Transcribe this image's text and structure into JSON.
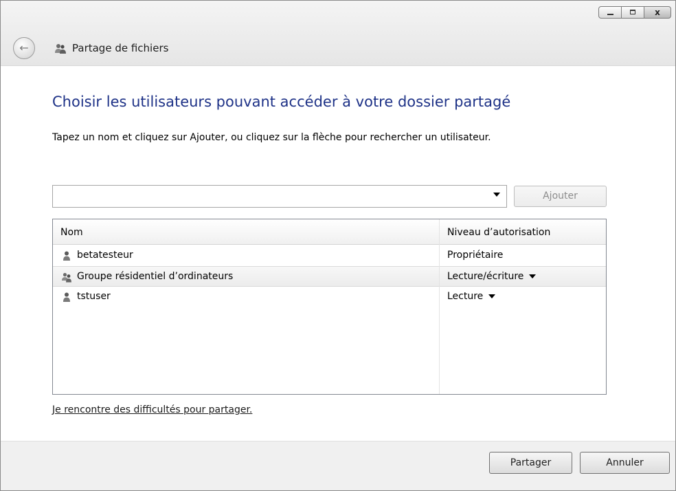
{
  "window": {
    "title": "Partage de fichiers",
    "close_glyph": "x"
  },
  "icons": {
    "back": "back-arrow-icon",
    "title": "users-share-icon",
    "user": "user-icon",
    "group": "group-icon",
    "dropdown": "chevron-down-icon"
  },
  "main": {
    "heading": "Choisir les utilisateurs pouvant accéder à votre dossier partagé",
    "instructions": "Tapez un nom et cliquez sur Ajouter, ou cliquez sur la flèche pour rechercher un utilisateur.",
    "name_input_value": "",
    "add_button": "Ajouter",
    "table": {
      "columns": [
        "Nom",
        "Niveau d’autorisation"
      ],
      "rows": [
        {
          "name": "betatesteur",
          "level": "Propriétaire"
        },
        {
          "name": "Groupe résidentiel d’ordinateurs",
          "level": "Lecture/écriture"
        },
        {
          "name": "tstuser",
          "level": "Lecture"
        }
      ]
    },
    "help_link": "Je rencontre des difficultés pour partager."
  },
  "footer": {
    "share_button": "Partager",
    "cancel_button": "Annuler"
  },
  "colors": {
    "heading": "#1e3287",
    "footer_bg": "#f0f0f0"
  }
}
